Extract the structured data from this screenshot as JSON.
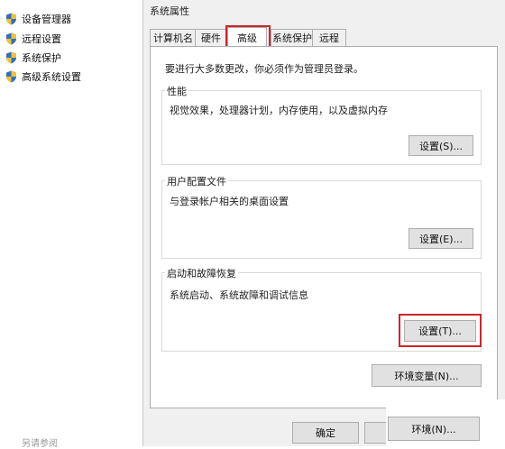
{
  "sidebar": {
    "items": [
      {
        "label": "设备管理器",
        "icon": "shield-icon"
      },
      {
        "label": "远程设置",
        "icon": "shield-icon"
      },
      {
        "label": "系统保护",
        "icon": "shield-icon"
      },
      {
        "label": "高级系统设置",
        "icon": "shield-icon"
      }
    ],
    "see_also": "另请参阅"
  },
  "dialog": {
    "title": "系统属性",
    "tabs": [
      {
        "label": "计算机名",
        "active": false
      },
      {
        "label": "硬件",
        "active": false
      },
      {
        "label": "高级",
        "active": true
      },
      {
        "label": "系统保护",
        "active": false
      },
      {
        "label": "远程",
        "active": false
      }
    ],
    "admin_note": "要进行大多数更改，你必须作为管理员登录。",
    "performance": {
      "title": "性能",
      "description": "视觉效果，处理器计划，内存使用，以及虚拟内存",
      "button": "设置(S)..."
    },
    "user_profiles": {
      "title": "用户配置文件",
      "description": "与登录帐户相关的桌面设置",
      "button": "设置(E)..."
    },
    "startup_recovery": {
      "title": "启动和故障恢复",
      "description": "系统启动、系统故障和调试信息",
      "button": "设置(T)..."
    },
    "env_button": "环境变量(N)...",
    "ok_button": "确定",
    "env_button_overlay": "环境(N)..."
  },
  "colors": {
    "highlight": "#d0232a",
    "shield_blue": "#2f6fc0",
    "shield_yellow": "#f2c230"
  }
}
